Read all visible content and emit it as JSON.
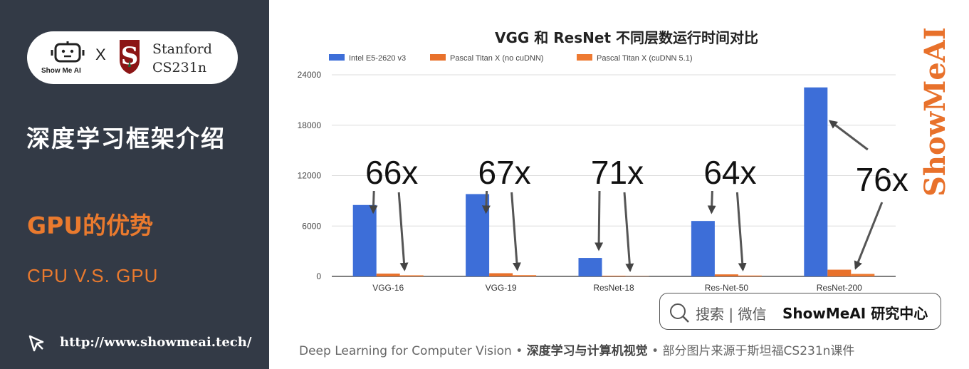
{
  "sidebar": {
    "logo_caption": "Show Me AI",
    "logo_x": "X",
    "stanford_line1": "Stanford",
    "stanford_line2": "CS231n",
    "title": "深度学习框架介绍",
    "section": "GPU的优势",
    "subsection": "CPU V.S. GPU",
    "url": "http://www.showmeai.tech/"
  },
  "watermark": "ShowMeAI",
  "search": {
    "label": "搜索 | 微信",
    "brand": "ShowMeAI 研究中心"
  },
  "footer": {
    "part1": "Deep Learning for Computer Vision",
    "sep": "•",
    "part2": "深度学习与计算机视觉",
    "part3": "部分图片来源于斯坦福CS231n课件"
  },
  "colors": {
    "sidebar_bg": "#333a46",
    "accent_orange": "#ea7a2e",
    "cpu_bar": "#3d6ed8",
    "gpu_bar": "#e8712b"
  },
  "chart_data": {
    "type": "bar",
    "title": "VGG 和 ResNet 不同层数运行时间对比",
    "categories": [
      "VGG-16",
      "VGG-19",
      "ResNet-18",
      "Res-Net-50",
      "ResNet-200"
    ],
    "series": [
      {
        "name": "Intel E5-2620 v3",
        "values": [
          8500,
          9800,
          2200,
          6600,
          22500
        ],
        "color": "#3d6ed8"
      },
      {
        "name": "Pascal Titan X (no cuDNN)",
        "values": [
          330,
          380,
          80,
          240,
          800
        ],
        "color": "#e8712b"
      },
      {
        "name": "Pascal Titan X (cuDNN 5.1)",
        "values": [
          130,
          150,
          31,
          103,
          296
        ],
        "color": "#ee7a32"
      }
    ],
    "ylim": [
      0,
      24000
    ],
    "yticks": [
      0,
      6000,
      12000,
      18000,
      24000
    ],
    "ytick_labels": [
      "0",
      "6000",
      "12000",
      "18000",
      "24000"
    ],
    "grid": true,
    "legend": "top-left",
    "annotations": [
      "66x",
      "67x",
      "71x",
      "64x",
      "76x"
    ]
  }
}
